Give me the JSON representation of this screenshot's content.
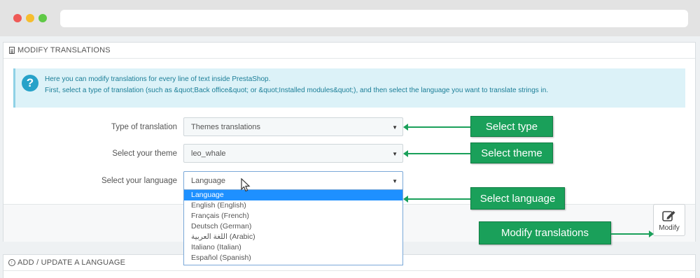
{
  "panel1": {
    "title": "MODIFY TRANSLATIONS",
    "alert": {
      "line1": "Here you can modify translations for every line of text inside PrestaShop.",
      "line2": "First, select a type of translation (such as &quot;Back office&quot; or &quot;Installed modules&quot;), and then select the language you want to translate strings in."
    },
    "fields": {
      "type_label": "Type of translation",
      "type_value": "Themes translations",
      "theme_label": "Select your theme",
      "theme_value": "leo_whale",
      "language_label": "Select your language",
      "language_value": "Language"
    },
    "language_options": [
      "Language",
      "English (English)",
      "Français (French)",
      "Deutsch (German)",
      "اللغة العربية (Arabic)",
      "Italiano (Italian)",
      "Español (Spanish)"
    ],
    "modify_label": "Modify"
  },
  "panel2": {
    "title": "ADD / UPDATE A LANGUAGE"
  },
  "annotations": {
    "select_type": "Select type",
    "select_theme": "Select theme",
    "select_language": "Select language",
    "modify_translations": "Modify translations"
  },
  "colors": {
    "accent_green": "#1aa05a",
    "info_blue": "#27a2c9",
    "selected_option": "#1e90ff"
  }
}
